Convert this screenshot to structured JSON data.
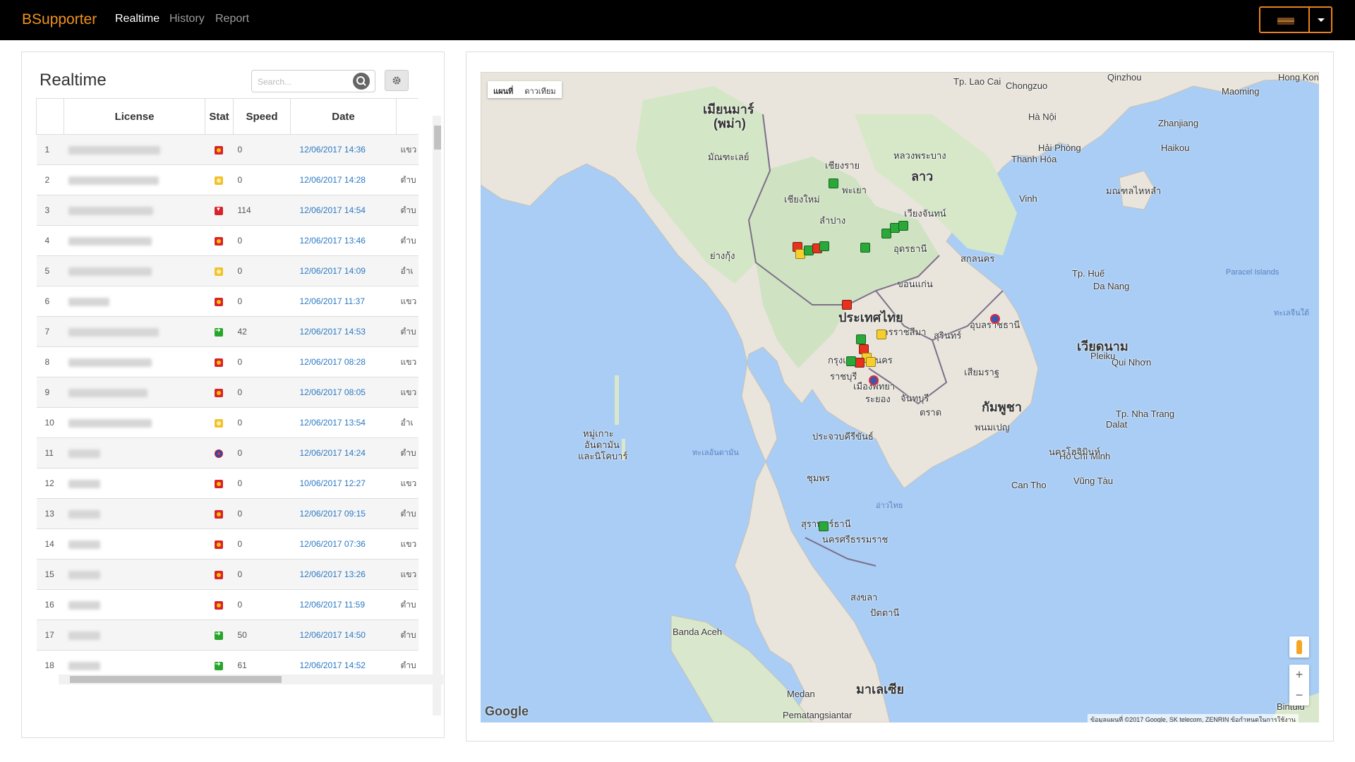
{
  "nav": {
    "brand": "BSupporter",
    "links": [
      "Realtime",
      "History",
      "Report"
    ],
    "active": "Realtime"
  },
  "panel": {
    "title": "Realtime",
    "search_placeholder": "Search..."
  },
  "table": {
    "headers": [
      "",
      "License",
      "Stat",
      "Speed",
      "Date"
    ],
    "rows": [
      {
        "num": "1",
        "stat": "red",
        "speed": "0",
        "date": "12/06/2017 14:36",
        "loc": "แขว"
      },
      {
        "num": "2",
        "stat": "yellow",
        "speed": "0",
        "date": "12/06/2017 14:28",
        "loc": "ตำบ"
      },
      {
        "num": "3",
        "stat": "wine",
        "speed": "114",
        "date": "12/06/2017 14:54",
        "loc": "ตำบ"
      },
      {
        "num": "4",
        "stat": "red",
        "speed": "0",
        "date": "12/06/2017 13:46",
        "loc": "ตำบ"
      },
      {
        "num": "5",
        "stat": "yellow",
        "speed": "0",
        "date": "12/06/2017 14:09",
        "loc": "อำเ"
      },
      {
        "num": "6",
        "stat": "red",
        "speed": "0",
        "date": "12/06/2017 11:37",
        "loc": "แขว"
      },
      {
        "num": "7",
        "stat": "green",
        "speed": "42",
        "date": "12/06/2017 14:53",
        "loc": "ตำบ"
      },
      {
        "num": "8",
        "stat": "red",
        "speed": "0",
        "date": "12/06/2017 08:28",
        "loc": "แขว"
      },
      {
        "num": "9",
        "stat": "red",
        "speed": "0",
        "date": "12/06/2017 08:05",
        "loc": "แขว"
      },
      {
        "num": "10",
        "stat": "yellow",
        "speed": "0",
        "date": "12/06/2017 13:54",
        "loc": "อำเ"
      },
      {
        "num": "11",
        "stat": "target",
        "speed": "0",
        "date": "12/06/2017 14:24",
        "loc": "ตำบ"
      },
      {
        "num": "12",
        "stat": "red",
        "speed": "0",
        "date": "10/06/2017 12:27",
        "loc": "แขว"
      },
      {
        "num": "13",
        "stat": "red",
        "speed": "0",
        "date": "12/06/2017 09:15",
        "loc": "ตำบ"
      },
      {
        "num": "14",
        "stat": "red",
        "speed": "0",
        "date": "12/06/2017 07:36",
        "loc": "แขว"
      },
      {
        "num": "15",
        "stat": "red",
        "speed": "0",
        "date": "12/06/2017 13:26",
        "loc": "แขว"
      },
      {
        "num": "16",
        "stat": "red",
        "speed": "0",
        "date": "12/06/2017 11:59",
        "loc": "ตำบ"
      },
      {
        "num": "17",
        "stat": "green",
        "speed": "50",
        "date": "12/06/2017 14:50",
        "loc": "ตำบ"
      },
      {
        "num": "18",
        "stat": "green",
        "speed": "61",
        "date": "12/06/2017 14:52",
        "loc": "ตำบ"
      }
    ]
  },
  "map": {
    "type_buttons": [
      "แผนที่",
      "ดาวเทียม"
    ],
    "countries": [
      "เมียนมาร์",
      "(พม่า)",
      "ลาว",
      "ประเทศไทย",
      "เวียดนาม",
      "กัมพูชา",
      "มาเลเซีย"
    ],
    "places": [
      "Hà Nội",
      "Hải Phòng",
      "Thanh Hóa",
      "Vinh",
      "Da Nang",
      "Tp. Huế",
      "Qui Nhơn",
      "Pleiku",
      "Tp. Nha Trang",
      "Dalat",
      "Hồ Chí Minh",
      "Vũng Tàu",
      "Can Tho",
      "Zhanjiang",
      "Haikou",
      "Maoming",
      "Qinzhou",
      "Chongzuo",
      "Hong Kong",
      "Tp. Lao Cai",
      "Banda Aceh",
      "Medan",
      "Pematangsiantar",
      "Bintulu",
      "Paracel Islands",
      "เชียงใหม่",
      "เชียงราย",
      "ลำปาง",
      "พะเยา",
      "อุดรธานี",
      "สกลนคร",
      "ขอนแก่น",
      "นครราชสีมา",
      "สุรินทร์",
      "อุบลราชธานี",
      "กรุงเทพมหานคร",
      "ราชบุรี",
      "เมืองพัทยา",
      "ระยอง",
      "จันทบุรี",
      "ตราด",
      "ประจวบคีรีขันธ์",
      "ชุมพร",
      "สุราษฎร์ธานี",
      "นครศรีธรรมราช",
      "สงขลา",
      "ปัตตานี",
      "หมู่เกาะ",
      "อันดามัน",
      "และนิโคบาร์",
      "ทะเลอันดามัน",
      "อ่าวไทย",
      "เสียมราฐ",
      "พนมเปญ",
      "นครโฮจิมินห์",
      "มณฑลไหหลำ",
      "ย่างกุ้ง",
      "มัณฑะเลย์",
      "เวียงจันทน์",
      "หลวงพระบาง",
      "ทะเลจีนใต้"
    ],
    "attribution": "ข้อมูลแผนที่ ©2017 Google, SK telecom, ZENRIN   ข้อกำหนดในการใช้งาน",
    "google_logo": "Google"
  }
}
